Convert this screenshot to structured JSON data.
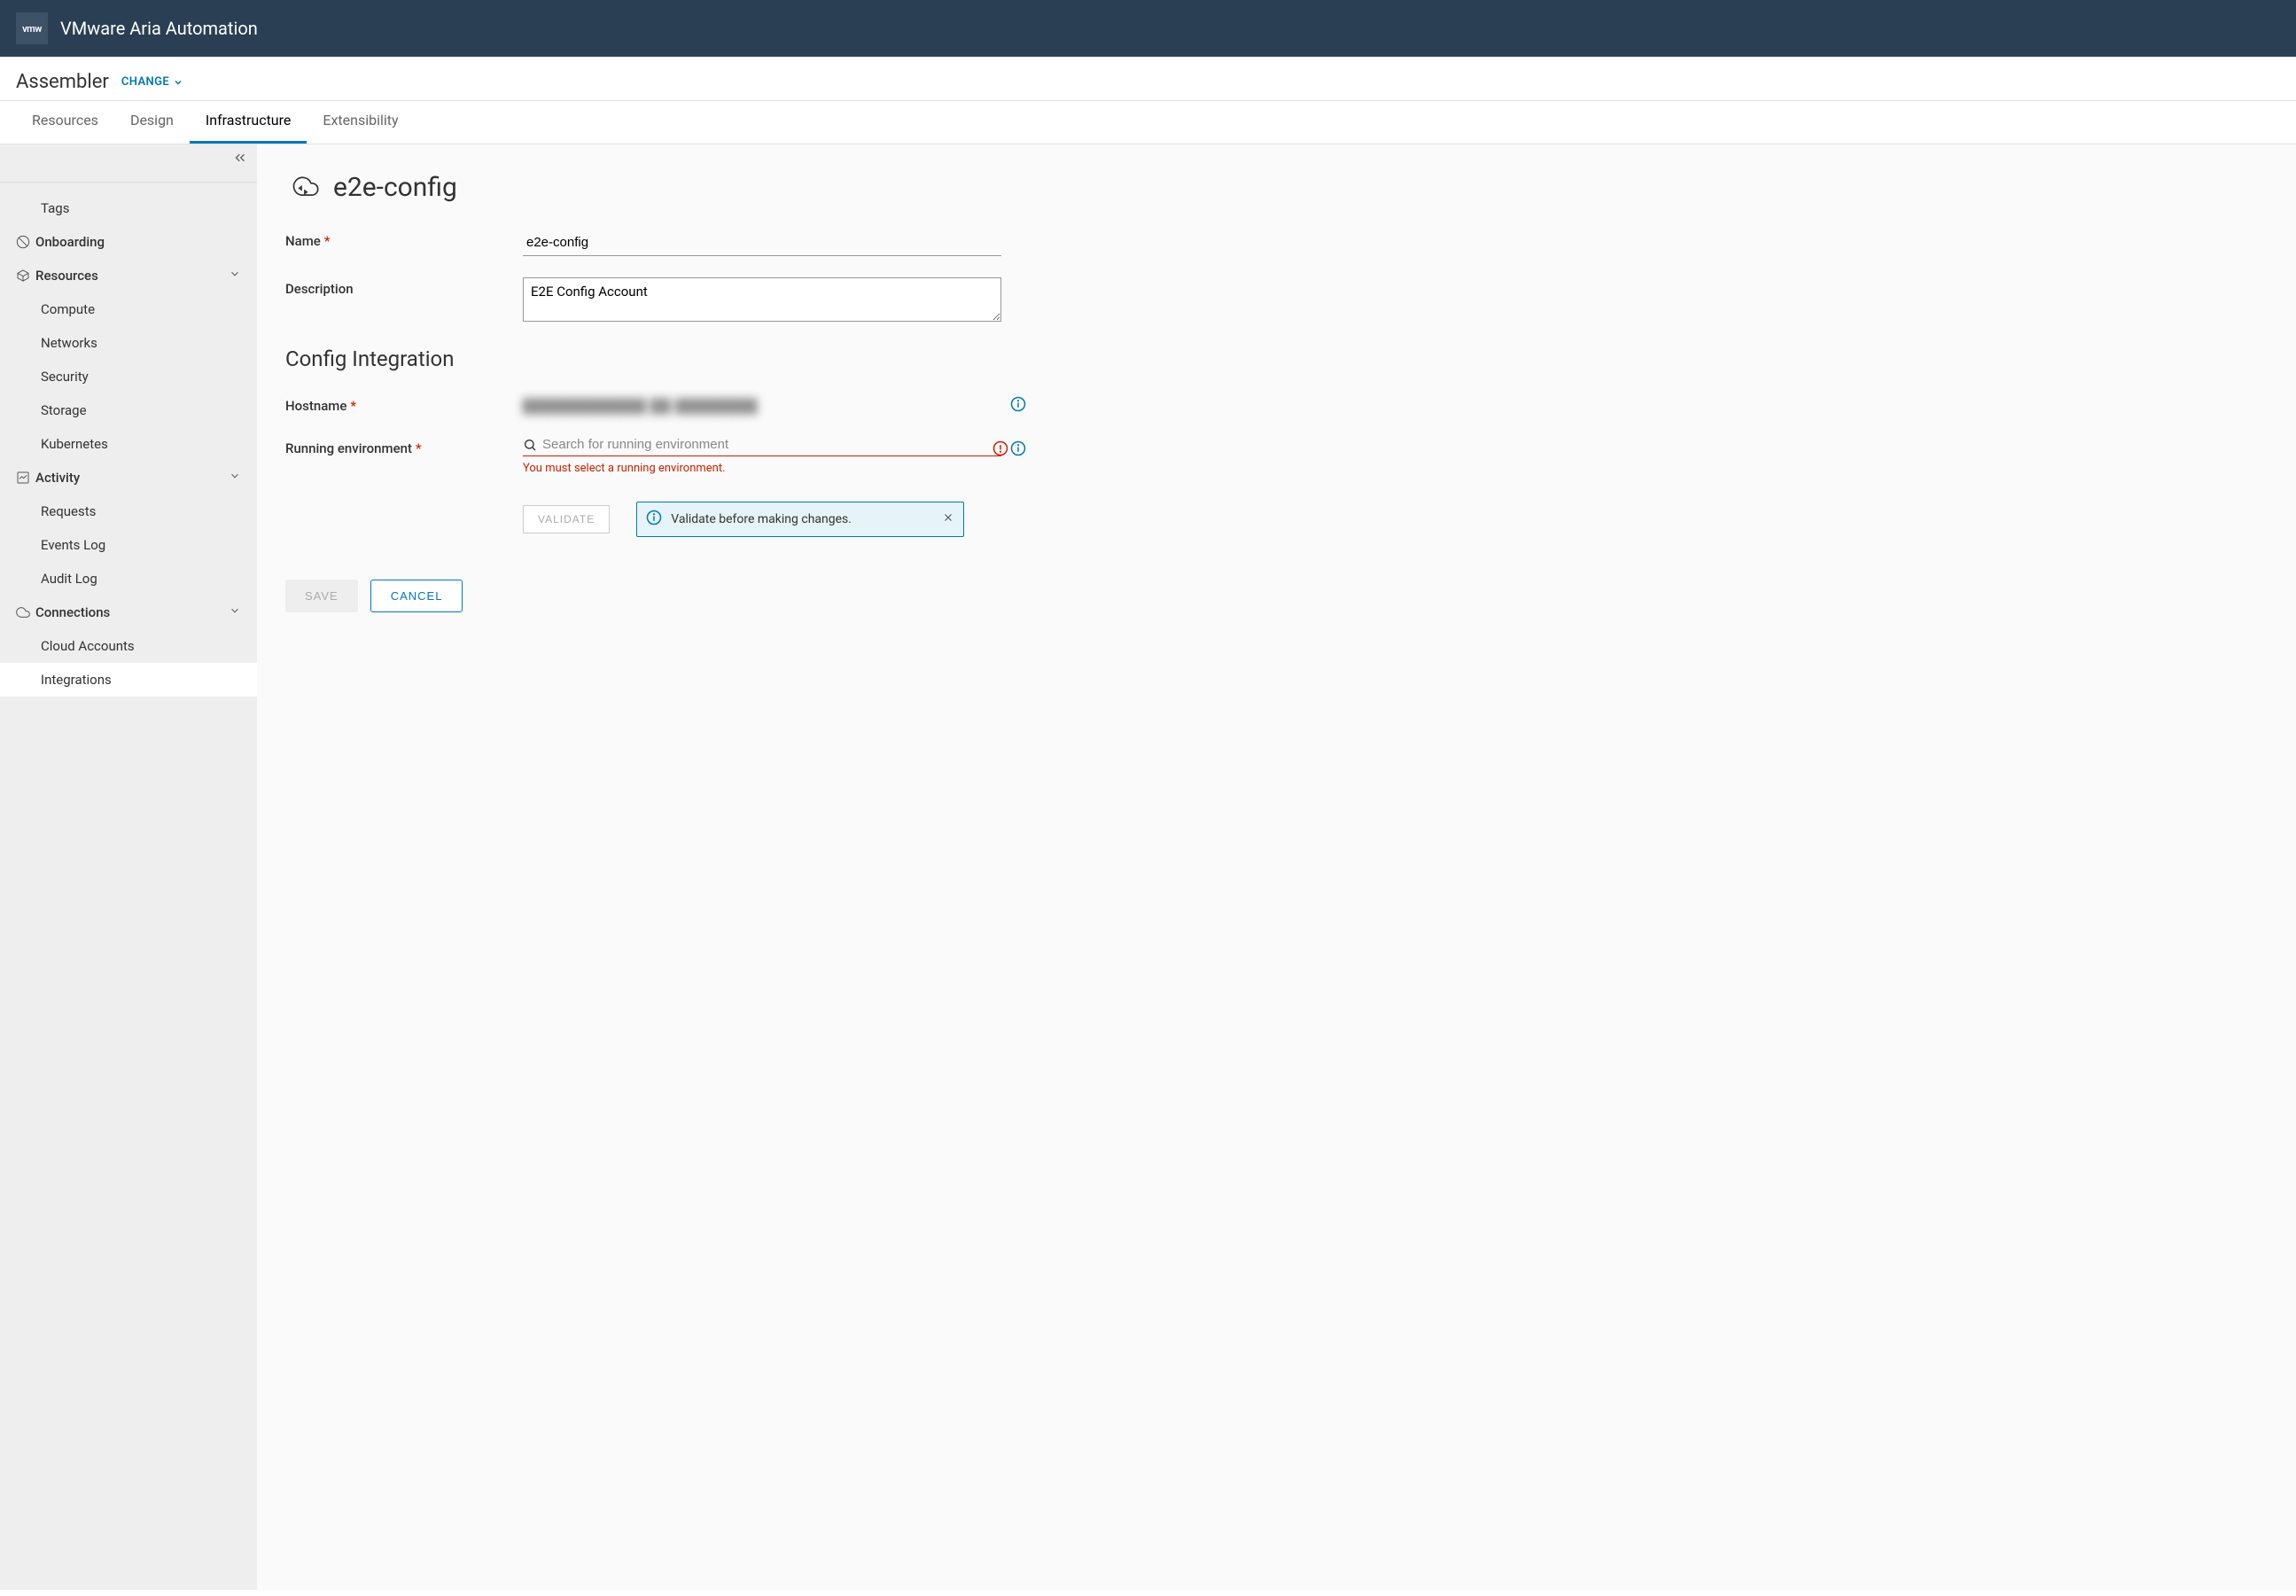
{
  "header": {
    "logo_text": "vmw",
    "product_title": "VMware Aria Automation"
  },
  "subheader": {
    "app_name": "Assembler",
    "change_label": "CHANGE"
  },
  "tabs": [
    {
      "label": "Resources",
      "active": false
    },
    {
      "label": "Design",
      "active": false
    },
    {
      "label": "Infrastructure",
      "active": true
    },
    {
      "label": "Extensibility",
      "active": false
    }
  ],
  "sidebar": {
    "items": [
      {
        "label": "Tags",
        "type": "child"
      },
      {
        "label": "Onboarding",
        "type": "section",
        "icon": "compass"
      },
      {
        "label": "Resources",
        "type": "section",
        "icon": "cube",
        "expandable": true
      },
      {
        "label": "Compute",
        "type": "child"
      },
      {
        "label": "Networks",
        "type": "child"
      },
      {
        "label": "Security",
        "type": "child"
      },
      {
        "label": "Storage",
        "type": "child"
      },
      {
        "label": "Kubernetes",
        "type": "child"
      },
      {
        "label": "Activity",
        "type": "section",
        "icon": "chart",
        "expandable": true
      },
      {
        "label": "Requests",
        "type": "child"
      },
      {
        "label": "Events Log",
        "type": "child"
      },
      {
        "label": "Audit Log",
        "type": "child"
      },
      {
        "label": "Connections",
        "type": "section",
        "icon": "cloud",
        "expandable": true
      },
      {
        "label": "Cloud Accounts",
        "type": "child"
      },
      {
        "label": "Integrations",
        "type": "child",
        "selected": true
      }
    ]
  },
  "main": {
    "page_title": "e2e-config",
    "name_label": "Name",
    "name_value": "e2e-config",
    "description_label": "Description",
    "description_value": "E2E Config Account",
    "section_title": "Config Integration",
    "hostname_label": "Hostname",
    "running_env_label": "Running environment",
    "running_env_placeholder": "Search for running environment",
    "running_env_error": "You must select a running environment.",
    "validate_label": "VALIDATE",
    "alert_text": "Validate before making changes.",
    "save_label": "SAVE",
    "cancel_label": "CANCEL"
  }
}
